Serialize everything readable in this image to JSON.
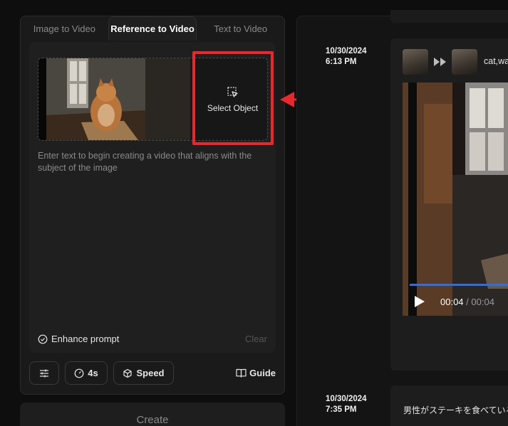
{
  "tabs": [
    "Image to Video",
    "Reference to Video",
    "Text to Video"
  ],
  "select_object_label": "Select Object",
  "prompt_placeholder": "Enter text to begin creating a video that aligns with the subject of the image",
  "enhance_label": "Enhance prompt",
  "clear_label": "Clear",
  "toolbar": {
    "duration": "4s",
    "speed": "Speed",
    "guide": "Guide"
  },
  "create_label": "Create",
  "history": [
    {
      "date": "10/30/2024",
      "time": "6:13 PM",
      "caption": "cat,wa",
      "current_time": "00:04",
      "separator": "/",
      "total_time": "00:04"
    },
    {
      "date": "10/30/2024",
      "time": "7:35 PM",
      "caption": "男性がステーキを食べている"
    }
  ],
  "colors": {
    "accent_red": "#e8282d",
    "progress_blue": "#2b6fe0"
  }
}
